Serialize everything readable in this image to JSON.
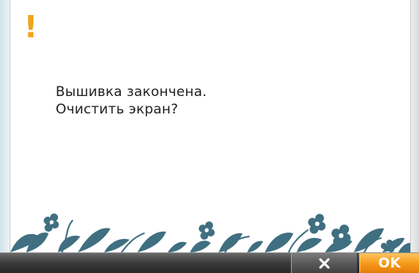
{
  "dialog": {
    "alert_symbol": "!",
    "message_line1": "Вышивка закончена.",
    "message_line2": "Очистить экран?"
  },
  "buttons": {
    "cancel_label": "×",
    "ok_label": "OK"
  },
  "colors": {
    "accent": "#f0a21c",
    "foliage": "#3f6f80",
    "bar": "#3c3c3c"
  },
  "icons": {
    "alert": "exclamation-icon",
    "cancel": "close-icon",
    "decoration": "foliage-decoration"
  }
}
